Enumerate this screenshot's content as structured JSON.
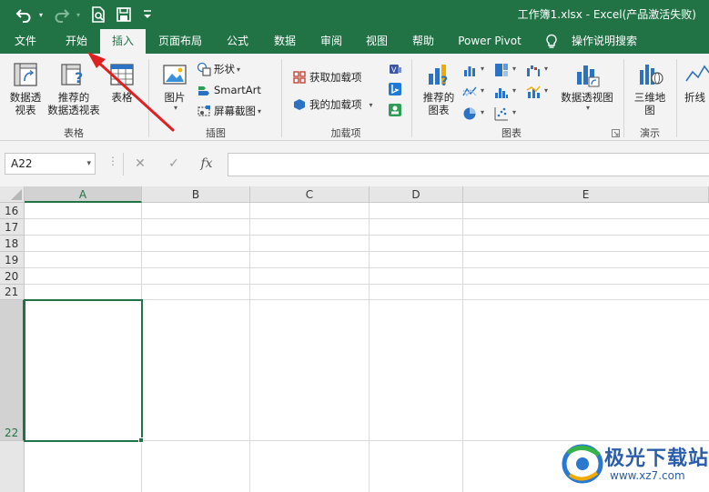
{
  "window": {
    "title": "工作簿1.xlsx  -  Excel(产品激活失败)"
  },
  "quick_access": {
    "undo_icon": "undo-icon",
    "redo_icon": "redo-icon",
    "print_preview_icon": "print-preview-icon",
    "save_icon": "save-icon",
    "customize_icon": "customize-qat-icon"
  },
  "tabs": [
    {
      "label": "文件"
    },
    {
      "label": "开始"
    },
    {
      "label": "插入"
    },
    {
      "label": "页面布局"
    },
    {
      "label": "公式"
    },
    {
      "label": "数据"
    },
    {
      "label": "审阅"
    },
    {
      "label": "视图"
    },
    {
      "label": "帮助"
    },
    {
      "label": "Power Pivot"
    },
    {
      "label": "操作说明搜索"
    }
  ],
  "active_tab": "插入",
  "ribbon": {
    "tables": {
      "group_label": "表格",
      "pivot_table": "数据透\n视表",
      "recommended_pivot": "推荐的\n数据透视表",
      "table": "表格"
    },
    "illustrations": {
      "group_label": "插图",
      "pictures": "图片",
      "shapes": "形状",
      "smartart": "SmartArt",
      "screenshot": "屏幕截图"
    },
    "addins": {
      "group_label": "加载项",
      "get_addins": "获取加载项",
      "my_addins": "我的加载项"
    },
    "charts": {
      "group_label": "图表",
      "recommended_charts": "推荐的\n图表",
      "pivot_chart": "数据透视图"
    },
    "tours": {
      "group_label": "演示",
      "map_3d": "三维地\n图"
    },
    "sparklines": {
      "line": "折线"
    }
  },
  "formula_bar": {
    "name_box": "A22",
    "cancel_symbol": "✕",
    "enter_symbol": "✓",
    "fx_symbol": "fx",
    "formula": ""
  },
  "grid": {
    "columns": [
      "A",
      "B",
      "C",
      "D",
      "E"
    ],
    "rows": [
      "16",
      "17",
      "18",
      "19",
      "20",
      "21",
      "22"
    ],
    "selected_cell": "A22"
  },
  "watermark": {
    "name": "极光下载站",
    "url": "www.xz7.com"
  },
  "colors": {
    "excel_green": "#217346",
    "ribbon_bg": "#f3f3f3",
    "annotation_red": "#e02020"
  }
}
